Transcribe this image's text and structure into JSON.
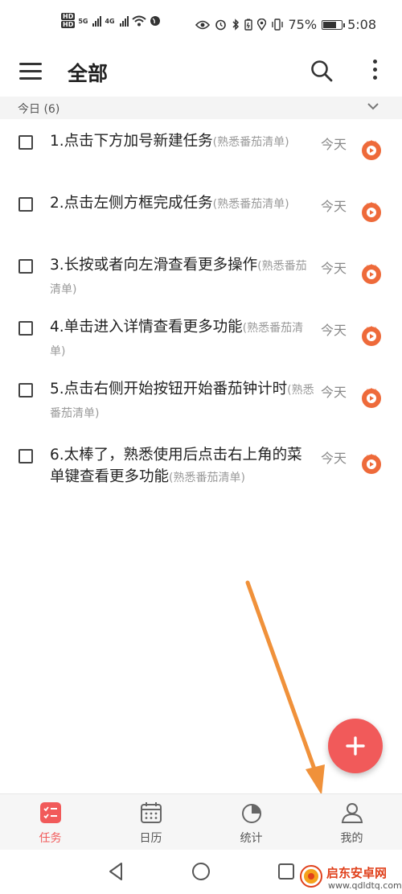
{
  "status_bar": {
    "hd_labels": [
      "HD",
      "HD"
    ],
    "network_1": "5G",
    "network_2": "4G",
    "battery_percent": "75%",
    "battery_level": 0.75,
    "time": "5:08"
  },
  "app_bar": {
    "title": "全部"
  },
  "section": {
    "label": "今日 (6)"
  },
  "tasks": [
    {
      "title": "1.点击下方加号新建任务",
      "list": "(熟悉番茄清单)",
      "date": "今天"
    },
    {
      "title": "2.点击左侧方框完成任务",
      "list": "(熟悉番茄清单)",
      "date": "今天"
    },
    {
      "title": "3.长按或者向左滑查看更多操作",
      "list": "(熟悉番茄清单)",
      "date": "今天"
    },
    {
      "title": "4.单击进入详情查看更多功能",
      "list": "(熟悉番茄清单)",
      "date": "今天"
    },
    {
      "title": "5.点击右侧开始按钮开始番茄钟计时",
      "list": "(熟悉番茄清单)",
      "date": "今天"
    },
    {
      "title": "6.太棒了，熟悉使用后点击右上角的菜单键查看更多功能",
      "list": "(熟悉番茄清单)",
      "date": "今天"
    }
  ],
  "bottom_nav": {
    "items": [
      {
        "label": "任务",
        "icon": "task-list-icon",
        "active": true
      },
      {
        "label": "日历",
        "icon": "calendar-icon",
        "active": false
      },
      {
        "label": "统计",
        "icon": "pie-chart-icon",
        "active": false
      },
      {
        "label": "我的",
        "icon": "person-icon",
        "active": false
      }
    ]
  },
  "watermark": {
    "title": "启东安卓网",
    "url": "www.qdldtq.com"
  },
  "colors": {
    "accent": "#f15a5a",
    "tomato": "#ee6a3a",
    "arrow": "#f0913a"
  }
}
